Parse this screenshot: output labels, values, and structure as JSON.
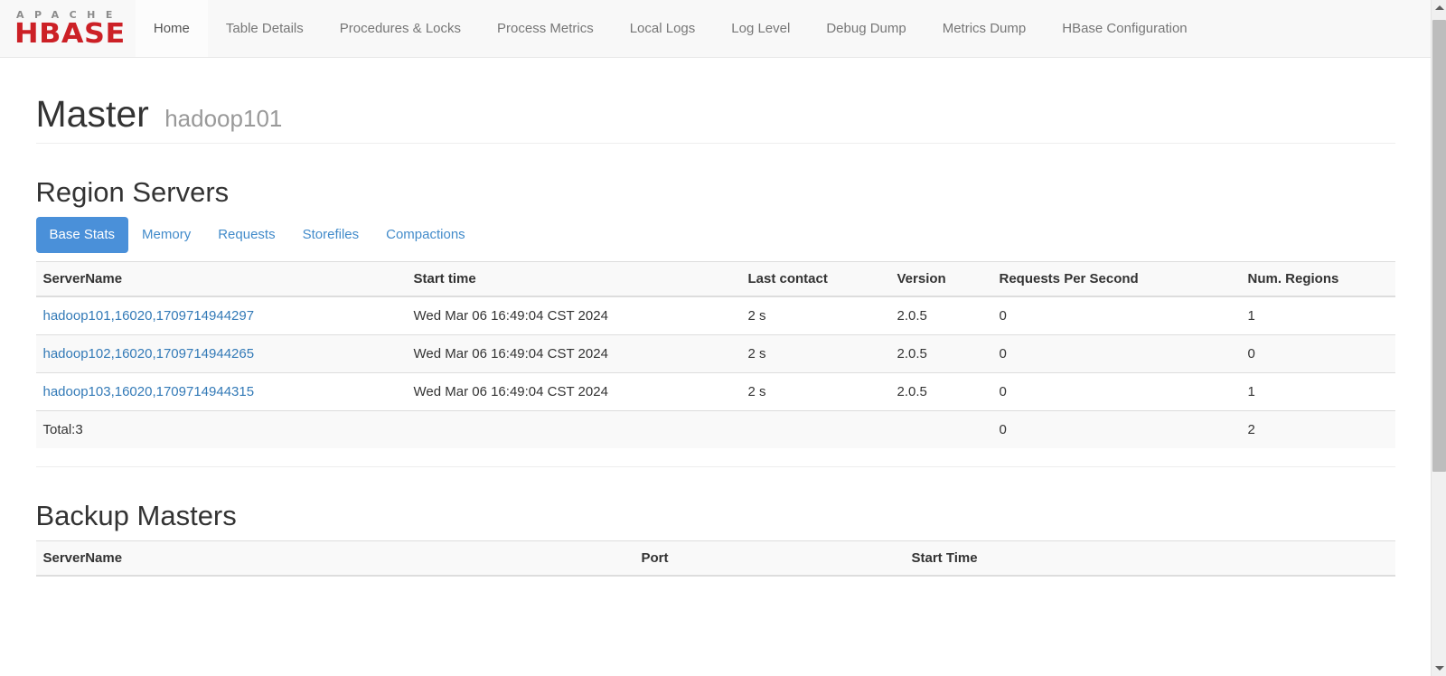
{
  "brand": {
    "apache": "APACHE",
    "hbase": "HBASE"
  },
  "nav": {
    "items": [
      {
        "label": "Home",
        "active": true
      },
      {
        "label": "Table Details",
        "active": false
      },
      {
        "label": "Procedures & Locks",
        "active": false
      },
      {
        "label": "Process Metrics",
        "active": false
      },
      {
        "label": "Local Logs",
        "active": false
      },
      {
        "label": "Log Level",
        "active": false
      },
      {
        "label": "Debug Dump",
        "active": false
      },
      {
        "label": "Metrics Dump",
        "active": false
      },
      {
        "label": "HBase Configuration",
        "active": false
      }
    ]
  },
  "page_header": {
    "title": "Master",
    "subtitle": "hadoop101"
  },
  "region_servers": {
    "section_title": "Region Servers",
    "tabs": [
      {
        "label": "Base Stats",
        "active": true
      },
      {
        "label": "Memory",
        "active": false
      },
      {
        "label": "Requests",
        "active": false
      },
      {
        "label": "Storefiles",
        "active": false
      },
      {
        "label": "Compactions",
        "active": false
      }
    ],
    "columns": [
      "ServerName",
      "Start time",
      "Last contact",
      "Version",
      "Requests Per Second",
      "Num. Regions"
    ],
    "rows": [
      {
        "server_name": "hadoop101,16020,1709714944297",
        "start_time": "Wed Mar 06 16:49:04 CST 2024",
        "last_contact": "2 s",
        "version": "2.0.5",
        "requests_per_second": "0",
        "num_regions": "1"
      },
      {
        "server_name": "hadoop102,16020,1709714944265",
        "start_time": "Wed Mar 06 16:49:04 CST 2024",
        "last_contact": "2 s",
        "version": "2.0.5",
        "requests_per_second": "0",
        "num_regions": "0"
      },
      {
        "server_name": "hadoop103,16020,1709714944315",
        "start_time": "Wed Mar 06 16:49:04 CST 2024",
        "last_contact": "2 s",
        "version": "2.0.5",
        "requests_per_second": "0",
        "num_regions": "1"
      }
    ],
    "total_row": {
      "label": "Total:3",
      "start_time": "",
      "last_contact": "",
      "version": "",
      "requests_per_second": "0",
      "num_regions": "2"
    }
  },
  "backup_masters": {
    "section_title": "Backup Masters",
    "columns": [
      "ServerName",
      "Port",
      "Start Time"
    ]
  },
  "colors": {
    "brand_red": "#cc2026",
    "brand_gray": "#8c8c8c",
    "link_blue": "#337ab7",
    "pill_active_bg": "#4a90d9",
    "navbar_bg": "#f8f8f8"
  },
  "scrollbar": {
    "up_arrow": "scroll-up-arrow",
    "down_arrow": "scroll-down-arrow"
  }
}
